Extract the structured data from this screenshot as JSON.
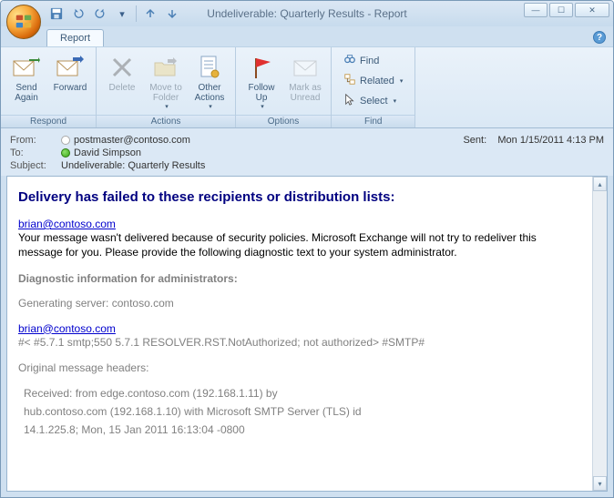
{
  "window": {
    "title": "Undeliverable: Quarterly Results - Report"
  },
  "tab": {
    "report": "Report"
  },
  "ribbon": {
    "respond": {
      "label": "Respond",
      "send_again": "Send\nAgain",
      "forward": "Forward"
    },
    "actions": {
      "label": "Actions",
      "delete": "Delete",
      "move": "Move to\nFolder",
      "other": "Other\nActions"
    },
    "options": {
      "label": "Options",
      "follow": "Follow\nUp",
      "mark": "Mark as\nUnread"
    },
    "find": {
      "label": "Find",
      "find": "Find",
      "related": "Related",
      "select": "Select"
    }
  },
  "headers": {
    "from_label": "From:",
    "from_value": "postmaster@contoso.com",
    "to_label": "To:",
    "to_value": "David Simpson",
    "subject_label": "Subject:",
    "subject_value": "Undeliverable: Quarterly Results",
    "sent_label": "Sent:",
    "sent_value": "Mon 1/15/2011 4:13 PM"
  },
  "body": {
    "headline": "Delivery has failed to these recipients or distribution lists:",
    "recipient1": "brian@contoso.com",
    "explain": "Your message wasn't delivered because of security policies. Microsoft Exchange will not try to redeliver this message for you. Please provide the following diagnostic text to your system administrator.",
    "diag_head": "Diagnostic information for administrators:",
    "gen_server": "Generating server: contoso.com",
    "recipient2": "brian@contoso.com",
    "diag_code": "#< #5.7.1 smtp;550 5.7.1 RESOLVER.RST.NotAuthorized; not authorized> #SMTP#",
    "orig_head": "Original message headers:",
    "recv1": "Received: from edge.contoso.com (192.168.1.11) by",
    "recv2": " hub.contoso.com (192.168.1.10) with Microsoft SMTP Server (TLS) id",
    "recv3": " 14.1.225.8;  Mon, 15 Jan 2011 16:13:04 -0800"
  }
}
